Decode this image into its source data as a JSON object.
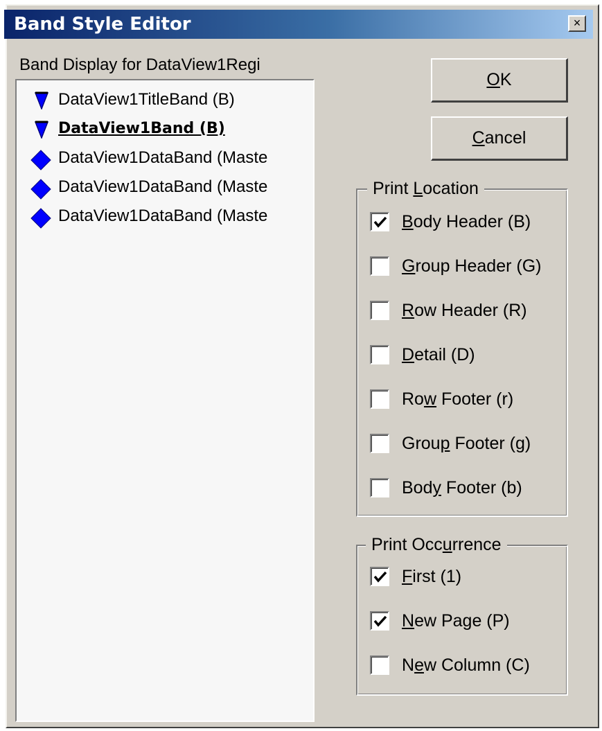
{
  "window": {
    "title": "Band Style Editor",
    "close_label": "×"
  },
  "band_list": {
    "label": "Band Display for DataView1Regi",
    "items": [
      {
        "label": "DataView1TitleBand (B)",
        "icon": "blue-triangle-icon",
        "bold": false
      },
      {
        "label": "DataView1Band (B)",
        "icon": "blue-triangle-icon",
        "bold": true
      },
      {
        "label": "DataView1DataBand (Maste",
        "icon": "blue-diamond-icon",
        "bold": false
      },
      {
        "label": "DataView1DataBand (Maste",
        "icon": "blue-diamond-icon",
        "bold": false
      },
      {
        "label": "DataView1DataBand (Maste",
        "icon": "blue-diamond-icon",
        "bold": false
      }
    ]
  },
  "buttons": {
    "ok": {
      "prefix": "",
      "mnemonic": "O",
      "rest": "K"
    },
    "cancel": {
      "prefix": "",
      "mnemonic": "C",
      "rest": "ancel"
    }
  },
  "print_location": {
    "title_prefix": "Print ",
    "title_mnemonic": "L",
    "title_rest": "ocation",
    "options": [
      {
        "prefix": "",
        "mnemonic": "B",
        "rest": "ody Header (B)",
        "checked": true
      },
      {
        "prefix": "",
        "mnemonic": "G",
        "rest": "roup Header (G)",
        "checked": false
      },
      {
        "prefix": "",
        "mnemonic": "R",
        "rest": "ow Header (R)",
        "checked": false
      },
      {
        "prefix": "",
        "mnemonic": "D",
        "rest": "etail (D)",
        "checked": false
      },
      {
        "prefix": "Ro",
        "mnemonic": "w",
        "rest": " Footer (r)",
        "checked": false
      },
      {
        "prefix": "Grou",
        "mnemonic": "p",
        "rest": " Footer (g)",
        "checked": false
      },
      {
        "prefix": "Bod",
        "mnemonic": "y",
        "rest": " Footer (b)",
        "checked": false
      }
    ]
  },
  "print_occurrence": {
    "title_prefix": "Print Occ",
    "title_mnemonic": "u",
    "title_rest": "rrence",
    "options": [
      {
        "prefix": "",
        "mnemonic": "F",
        "rest": "irst (1)",
        "checked": true
      },
      {
        "prefix": "",
        "mnemonic": "N",
        "rest": "ew Page (P)",
        "checked": true
      },
      {
        "prefix": "N",
        "mnemonic": "e",
        "rest": "w Column (C)",
        "checked": false
      }
    ]
  },
  "colors": {
    "dialog_face": "#d4d0c8",
    "titlebar_start": "#0a246a",
    "titlebar_end": "#a6caf0",
    "icon_blue": "#0000ff"
  }
}
